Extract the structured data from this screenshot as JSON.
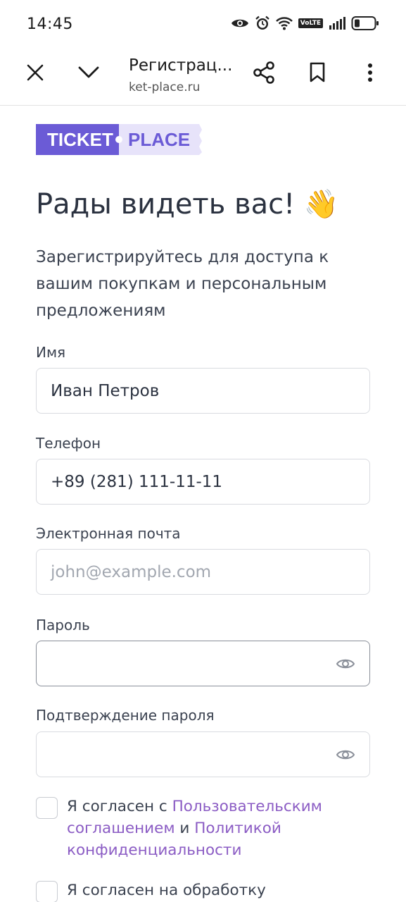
{
  "status_bar": {
    "time": "14:45",
    "network_badge": "VoLTE",
    "icons": [
      "eye-icon",
      "alarm-icon",
      "wifi-icon",
      "signal-icon",
      "battery-icon"
    ]
  },
  "toolbar": {
    "page_title": "Регистрац...",
    "url": "ket-place.ru",
    "icons": [
      "close-icon",
      "chevron-down-icon",
      "share-icon",
      "bookmark-icon",
      "more-vert-icon"
    ]
  },
  "logo": {
    "word1": "TICKET",
    "word2": "PLACE",
    "colors": {
      "dark": "#6b5bd6",
      "light": "#e7e3fa",
      "dark_text": "#ffffff",
      "light_text": "#6b5bd6"
    }
  },
  "form": {
    "heading": "Рады видеть вас! 👋",
    "subtitle": "Зарегистрируйтесь для доступа к вашим покупкам и персональным предложениям",
    "name": {
      "label": "Имя",
      "value": "Иван Петров"
    },
    "phone": {
      "label": "Телефон",
      "value": "+89 (281) 111-11-11"
    },
    "email": {
      "label": "Электронная почта",
      "placeholder": "john@example.com"
    },
    "password": {
      "label": "Пароль",
      "value": ""
    },
    "password_confirm": {
      "label": "Подтверждение пароля",
      "value": ""
    },
    "agree_terms": {
      "text_before": "Я согласен с ",
      "link1": "Пользовательским соглашением",
      "text_middle": " и ",
      "link2": "Политикой конфиденциальности"
    },
    "agree_processing": {
      "text": "Я согласен на обработку"
    }
  },
  "colors": {
    "link": "#8b5cc4",
    "text": "#2b3240",
    "border": "#d9dbe0"
  }
}
